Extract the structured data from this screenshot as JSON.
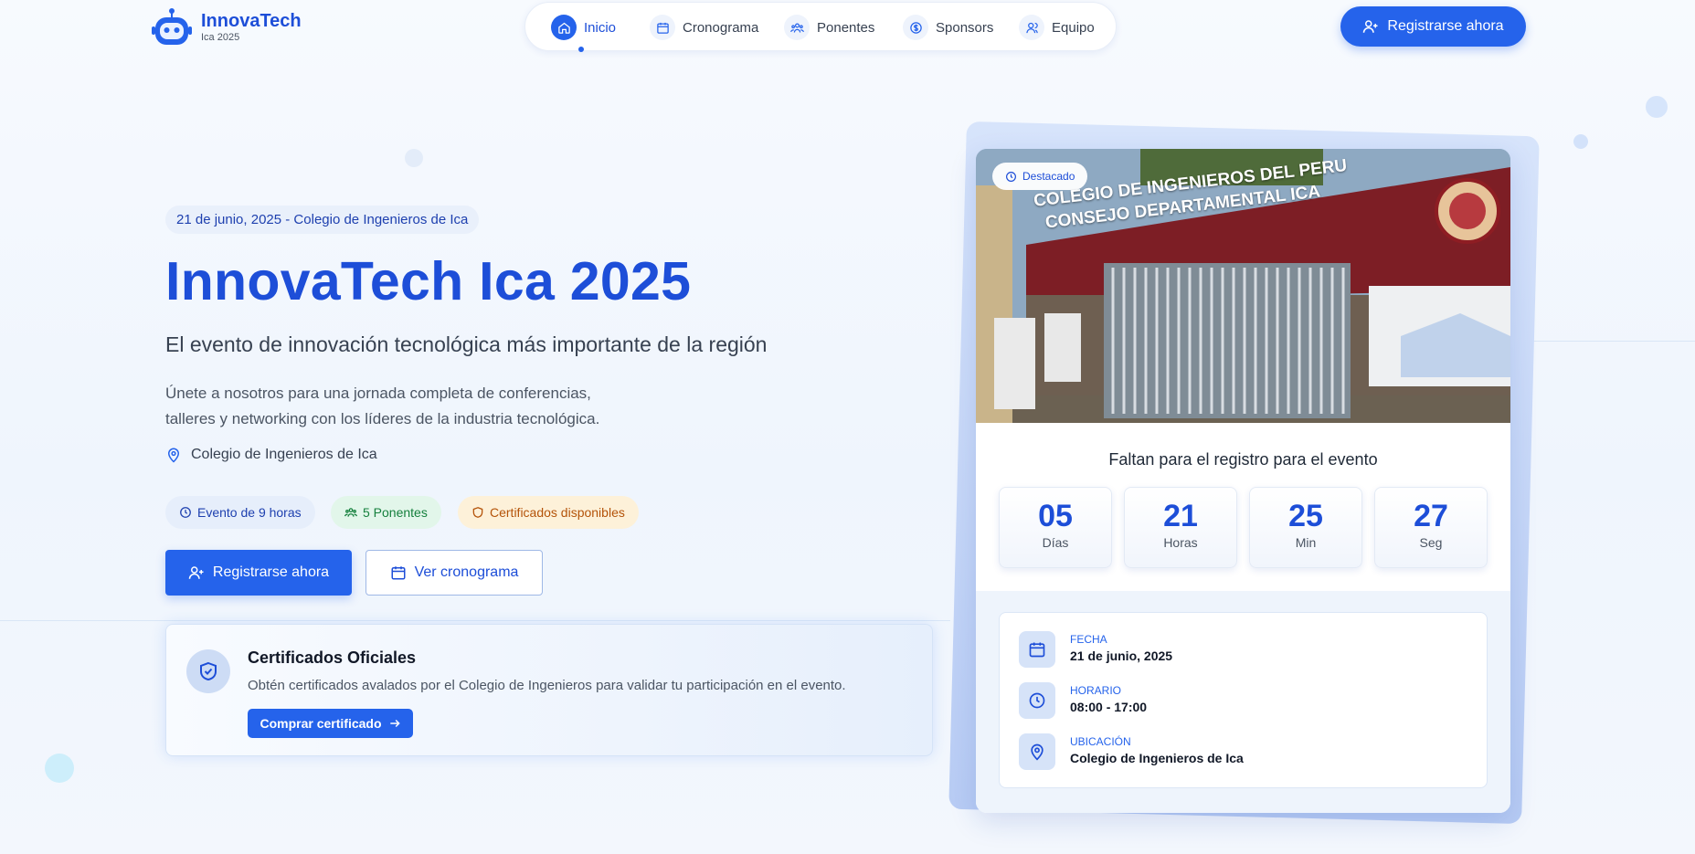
{
  "brand": {
    "name": "InnovaTech",
    "subtitle": "Ica 2025",
    "icon": "robot-icon"
  },
  "nav": {
    "items": [
      {
        "label": "Inicio",
        "icon": "home-icon",
        "active": true
      },
      {
        "label": "Cronograma",
        "icon": "calendar-icon",
        "active": false
      },
      {
        "label": "Ponentes",
        "icon": "users-icon",
        "active": false
      },
      {
        "label": "Sponsors",
        "icon": "dollar-icon",
        "active": false
      },
      {
        "label": "Equipo",
        "icon": "team-icon",
        "active": false
      }
    ]
  },
  "header": {
    "register_label": "Registrarse ahora"
  },
  "hero": {
    "date_badge": "21 de junio, 2025 - Colegio de Ingenieros de Ica",
    "title": "InnovaTech Ica 2025",
    "subtitle": "El evento de innovación tecnológica más importante de la región",
    "description_line1": "Únete a nosotros para una jornada completa de conferencias,",
    "description_line2": "talleres y networking con los líderes de la industria tecnológica.",
    "location": "Colegio de Ingenieros de Ica",
    "pills": [
      {
        "label": "Evento de 9 horas",
        "icon": "clock-icon"
      },
      {
        "label": "5 Ponentes",
        "icon": "users-icon"
      },
      {
        "label": "Certificados disponibles",
        "icon": "shield-icon"
      }
    ],
    "primary_button": "Registrarse ahora",
    "secondary_button": "Ver cronograma"
  },
  "certificate": {
    "title": "Certificados Oficiales",
    "description": "Obtén certificados avalados por el Colegio de Ingenieros para validar tu participación en el evento.",
    "button": "Comprar certificado"
  },
  "event_card": {
    "badge": "Destacado",
    "photo_sign_line1": "COLEGIO DE INGENIEROS DEL PERU",
    "photo_sign_line2": "CONSEJO DEPARTAMENTAL ICA",
    "countdown_title": "Faltan para el registro para el evento",
    "countdown": [
      {
        "value": "05",
        "unit": "Días"
      },
      {
        "value": "21",
        "unit": "Horas"
      },
      {
        "value": "25",
        "unit": "Min"
      },
      {
        "value": "27",
        "unit": "Seg"
      }
    ],
    "details": [
      {
        "label": "FECHA",
        "value": "21 de junio, 2025",
        "icon": "calendar-icon"
      },
      {
        "label": "HORARIO",
        "value": "08:00 - 17:00",
        "icon": "clock-icon"
      },
      {
        "label": "UBICACIÓN",
        "value": "Colegio de Ingenieros de Ica",
        "icon": "location-pin-icon"
      }
    ]
  },
  "colors": {
    "primary": "#2563eb",
    "primary_dark": "#1d4ed8",
    "green": "#15803d",
    "amber": "#b45309"
  }
}
